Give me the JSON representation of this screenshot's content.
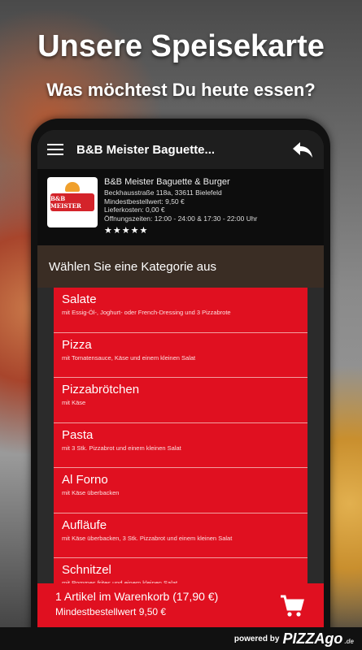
{
  "promo": {
    "headline": "Unsere Speisekarte",
    "subline": "Was möchtest Du heute essen?"
  },
  "appbar": {
    "title": "B&B Meister Baguette..."
  },
  "restaurant": {
    "logo_text": "B&B MEISTER",
    "name": "B&B Meister Baguette & Burger",
    "address": "Beckhausstraße 118a, 33611 Bielefeld",
    "min_order": "Mindestbestellwert: 9,50 €",
    "delivery_cost": "Lieferkosten: 0,00 €",
    "hours": "Öffnungszeiten: 12:00 - 24:00 & 17:30 - 22:00 Uhr",
    "rating_stars": "★★★★★",
    "rating": 5
  },
  "category_header": "Wählen Sie eine Kategorie aus",
  "categories": [
    {
      "title": "Salate",
      "desc": "mit Essig-Öl-, Joghurt- oder French-Dressing und 3 Pizzabrote"
    },
    {
      "title": "Pizza",
      "desc": "mit Tomatensauce, Käse und einem kleinen Salat"
    },
    {
      "title": "Pizzabrötchen",
      "desc": "mit Käse"
    },
    {
      "title": "Pasta",
      "desc": "mit 3 Stk. Pizzabrot und einem kleinen Salat"
    },
    {
      "title": "Al Forno",
      "desc": "mit Käse überbacken"
    },
    {
      "title": "Aufläufe",
      "desc": "mit Käse überbacken, 3 Stk. Pizzabrot und einem kleinen Salat"
    },
    {
      "title": "Schnitzel",
      "desc": "mit Pommes frites und einem kleinen Salat"
    }
  ],
  "cart": {
    "summary": "1 Artikel im Warenkorb (17,90 €)",
    "min_order": "Mindestbestellwert 9,50 €",
    "icon": "cart-icon"
  },
  "footer": {
    "powered_by": "powered by",
    "brand_prefix": "go",
    "brand_main": "PIZZAgo",
    "brand_suffix": ".de"
  },
  "colors": {
    "accent": "#e01020",
    "appbar": "#1e1e1e",
    "category_header_bg": "#3a2d24"
  }
}
